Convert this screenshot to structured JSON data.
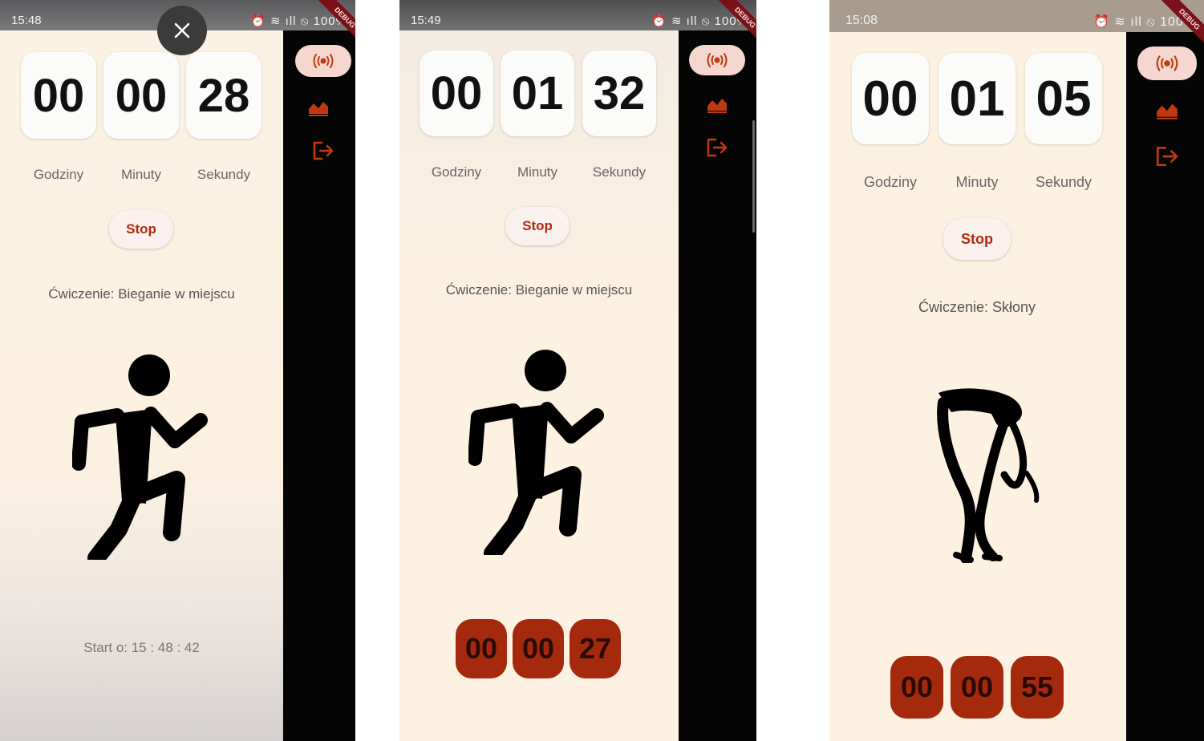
{
  "screens": [
    {
      "status_time": "15:48",
      "status_right": "⏰ ≋ ıll ⦸ 100%",
      "timer": {
        "hours": "00",
        "minutes": "00",
        "seconds": "28"
      },
      "labels": {
        "hours": "Godziny",
        "minutes": "Minuty",
        "seconds": "Sekundy"
      },
      "stop_label": "Stop",
      "exercise": "Ćwiczenie: Bieganie w miejscu",
      "start_text": "Start o: 15 : 48 : 42",
      "debug": "DEBUG",
      "close_icon": "×",
      "figure": "runner"
    },
    {
      "status_time": "15:49",
      "status_right": "⏰ ≋ ıll ⦸ 100%",
      "timer": {
        "hours": "00",
        "minutes": "01",
        "seconds": "32"
      },
      "labels": {
        "hours": "Godziny",
        "minutes": "Minuty",
        "seconds": "Sekundy"
      },
      "stop_label": "Stop",
      "exercise": "Ćwiczenie: Bieganie w miejscu",
      "countdown": {
        "hours": "00",
        "minutes": "00",
        "seconds": "27"
      },
      "debug": "DEBUG",
      "figure": "runner"
    },
    {
      "status_time": "15:08",
      "status_right": "⏰ ≋ ıll ⦸ 100%",
      "timer": {
        "hours": "00",
        "minutes": "01",
        "seconds": "05"
      },
      "labels": {
        "hours": "Godziny",
        "minutes": "Minuty",
        "seconds": "Sekundy"
      },
      "stop_label": "Stop",
      "exercise": "Ćwiczenie: Skłony",
      "countdown": {
        "hours": "00",
        "minutes": "00",
        "seconds": "55"
      },
      "debug": "DEBUG",
      "figure": "forward-bend"
    }
  ],
  "rail_icons": [
    "broadcast-icon",
    "chart-icon",
    "logout-icon"
  ],
  "colors": {
    "accent": "#c0390f",
    "cream": "#fdf1e1",
    "countdown_bg": "#a52a0d",
    "rail": "#050505"
  }
}
